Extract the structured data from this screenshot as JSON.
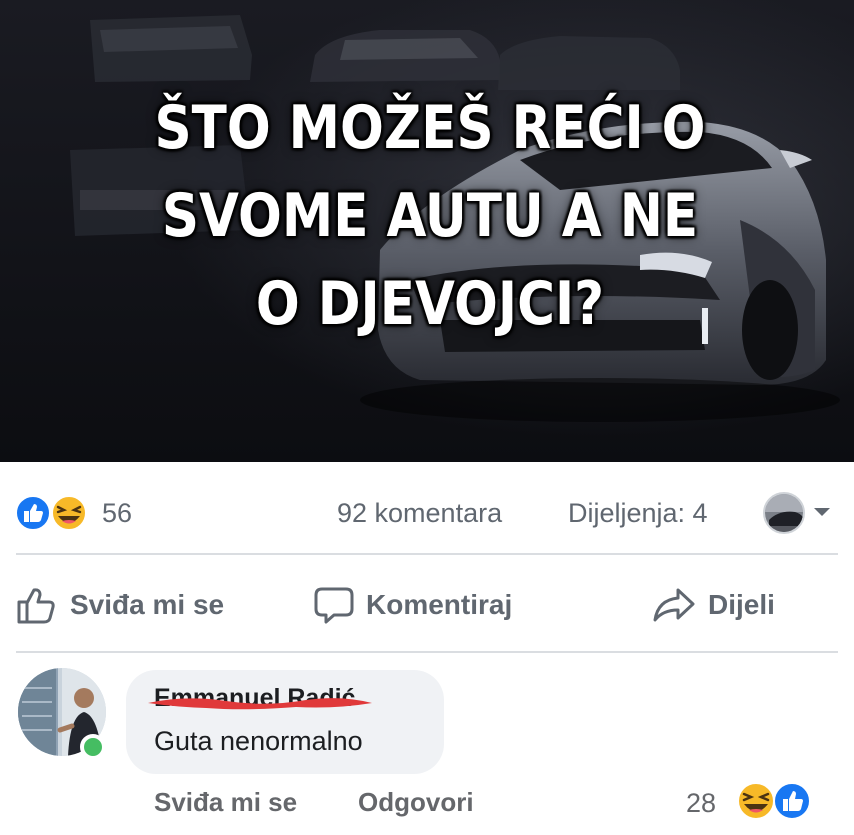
{
  "post": {
    "image": {
      "caption_lines": [
        "ŠTO MOŽEŠ REĆI O",
        "SVOME AUTU A NE",
        "O DJEVOJCI?"
      ]
    },
    "stats": {
      "reaction_count": "56",
      "reaction_icons": [
        "like-icon",
        "haha-icon"
      ],
      "comments_label": "92 komentara",
      "shares_label": "Dijeljenja: 4"
    },
    "actions": {
      "like_label": "Sviđa mi se",
      "comment_label": "Komentiraj",
      "share_label": "Dijeli"
    }
  },
  "comment": {
    "author_name": "Emmanuel Radić",
    "text": "Guta nenormalno",
    "like_label": "Sviđa mi se",
    "reply_label": "Odgovori",
    "reaction_count": "28",
    "reaction_icons": [
      "haha-icon",
      "like-icon"
    ],
    "online": true
  },
  "colors": {
    "like_blue": "#1877f2",
    "haha_yellow": "#f7b928",
    "online_green": "#45bd62",
    "redaction_red": "#e0393a",
    "secondary_text": "#606770"
  }
}
